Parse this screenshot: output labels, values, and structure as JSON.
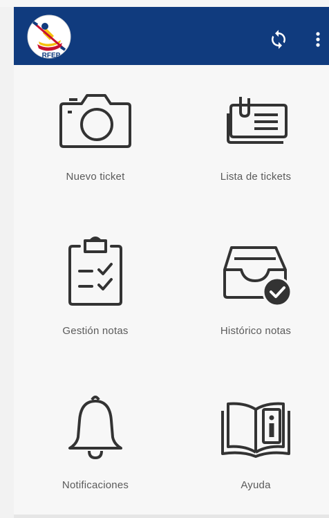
{
  "app": {
    "logo_text": "RFEP",
    "colors": {
      "toolbar": "#103b7e",
      "icon_stroke": "#333333",
      "label": "#5a5a5a"
    }
  },
  "toolbar": {
    "sync_icon": "sync-icon",
    "menu_icon": "more-vert-icon"
  },
  "menu": {
    "items": [
      {
        "label": "Nuevo ticket",
        "icon": "camera-icon"
      },
      {
        "label": "Lista de tickets",
        "icon": "ticket-list-icon"
      },
      {
        "label": "Gestión notas",
        "icon": "clipboard-check-icon"
      },
      {
        "label": "Histórico notas",
        "icon": "inbox-check-icon"
      },
      {
        "label": "Notificaciones",
        "icon": "bell-icon"
      },
      {
        "label": "Ayuda",
        "icon": "book-info-icon"
      }
    ]
  }
}
